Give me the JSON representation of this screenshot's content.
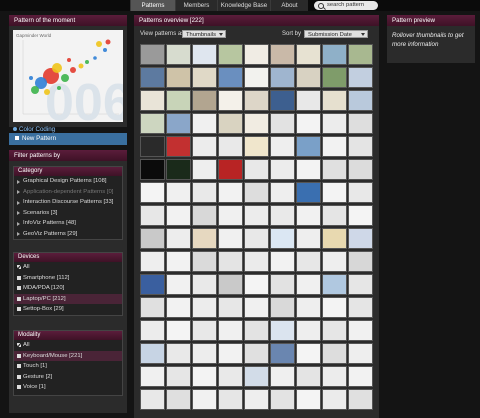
{
  "nav": {
    "tabs": [
      {
        "label": "Patterns",
        "active": true
      },
      {
        "label": "Members",
        "active": false
      },
      {
        "label": "Knowledge Base",
        "active": false
      },
      {
        "label": "About",
        "active": false
      }
    ],
    "search_placeholder": "search pattern"
  },
  "potm": {
    "title": "Pattern of the moment",
    "image_label": "Gapminder World",
    "year_overlay": "006",
    "color_link": "Color Coding"
  },
  "new_pattern_label": "New Pattern",
  "filter": {
    "title": "Filter patterns by",
    "category": {
      "title": "Category",
      "items": [
        {
          "label": "Graphical Design Patterns [108]",
          "dim": false
        },
        {
          "label": "Application-dependent Patterns [0]",
          "dim": true
        },
        {
          "label": "Interaction Discourse Patterns [33]",
          "dim": false
        },
        {
          "label": "Scenarios [3]",
          "dim": false
        },
        {
          "label": "InfoViz Patterns [48]",
          "dim": false
        },
        {
          "label": "GeoViz Patterns [29]",
          "dim": false
        }
      ]
    },
    "devices": {
      "title": "Devices",
      "items": [
        {
          "label": "All",
          "checked": true,
          "highlight": false
        },
        {
          "label": "Smartphone [112]",
          "checked": false,
          "highlight": false
        },
        {
          "label": "MDA/PDA [120]",
          "checked": false,
          "highlight": false
        },
        {
          "label": "Laptop/PC [212]",
          "checked": false,
          "highlight": true
        },
        {
          "label": "Settop-Box [29]",
          "checked": false,
          "highlight": false
        }
      ]
    },
    "modality": {
      "title": "Modality",
      "items": [
        {
          "label": "All",
          "checked": true,
          "highlight": false
        },
        {
          "label": "Keyboard/Mouse [221]",
          "checked": false,
          "highlight": true
        },
        {
          "label": "Touch [1]",
          "checked": false,
          "highlight": false
        },
        {
          "label": "Gesture [2]",
          "checked": false,
          "highlight": false
        },
        {
          "label": "Voice [1]",
          "checked": false,
          "highlight": false
        }
      ]
    }
  },
  "overview": {
    "title": "Patterns overview [222]",
    "view_label": "View patterns as",
    "view_value": "Thumbnails",
    "sort_label": "Sort by",
    "sort_value": "Submission Date",
    "thumb_colors": [
      "#9a9a9a",
      "#d7dccf",
      "#dfe6ef",
      "#b7c6a0",
      "#f0ece4",
      "#c9b9a8",
      "#e7e2d2",
      "#8fb0c8",
      "#a8b890",
      "#5d7aa0",
      "#cfc3a8",
      "#e0d9c7",
      "#6a8fbf",
      "#f2f2ee",
      "#9fb5cf",
      "#d8d2c2",
      "#7f9c6a",
      "#c2cfe0",
      "#e9e4d8",
      "#c8d4b8",
      "#b2a590",
      "#f4f1ea",
      "#ddd6c8",
      "#3d5f8f",
      "#e8e8e8",
      "#e6e0cf",
      "#b9c9dc",
      "#cdd6c0",
      "#8aa6c9",
      "#f0f0f0",
      "#d9d3c1",
      "#f1ece2",
      "#e2e2e2",
      "#f3f3f3",
      "#ececec",
      "#dedede",
      "#2a2a2a",
      "#c23030",
      "#ececec",
      "#e9e9e9",
      "#f0e6cc",
      "#eeeeee",
      "#7aa0c8",
      "#f2f2f2",
      "#e4e4e4",
      "#0b0b0b",
      "#1a2a1a",
      "#eeeeee",
      "#b82424",
      "#e8e8e8",
      "#ececec",
      "#f3f3f3",
      "#e0e0e0",
      "#dcdcdc",
      "#f4f4f4",
      "#f0f0f0",
      "#e9e9e9",
      "#f2f2f2",
      "#dddddd",
      "#eeeeee",
      "#3a6fb0",
      "#f3f3f3",
      "#e8e8e8",
      "#e7e7e7",
      "#f2f2f2",
      "#d8d8d8",
      "#f0f0f0",
      "#ececec",
      "#e9e9e9",
      "#f1f1f1",
      "#e5e5e5",
      "#f4f4f4",
      "#c9c9c9",
      "#ededed",
      "#e6d8c0",
      "#f0f0f0",
      "#e8e8e8",
      "#dbe7f3",
      "#eeeeee",
      "#e8d9b0",
      "#cfd8e8",
      "#eeeeee",
      "#f2f2f2",
      "#dadada",
      "#e4e4e4",
      "#ebebeb",
      "#f2f2f2",
      "#e7e7e7",
      "#eeeeee",
      "#d7d7d7",
      "#3a5f9f",
      "#f1f1f1",
      "#e9e9e9",
      "#c9c9c9",
      "#f4f4f4",
      "#e2e2e2",
      "#f0f0f0",
      "#b0c8e0",
      "#e6e6e6",
      "#e0e0e0",
      "#f2f2f2",
      "#ececec",
      "#e7e7e7",
      "#f0f0f0",
      "#d9d9d9",
      "#eeeeee",
      "#f3f3f3",
      "#e5e5e5",
      "#ececec",
      "#f4f4f4",
      "#e8e8e8",
      "#f0f0f0",
      "#e3e3e3",
      "#dbe4ef",
      "#eeeeee",
      "#e6e6e6",
      "#f1f1f1",
      "#c7d4e4",
      "#e9e9e9",
      "#ededed",
      "#f2f2f2",
      "#e0e0e0",
      "#6a86b0",
      "#f4f4f4",
      "#dddddd",
      "#eeeeee",
      "#f0f0f0",
      "#e6e6e6",
      "#f3f3f3",
      "#e9e9e9",
      "#d2dce8",
      "#efefef",
      "#e4e4e4",
      "#ececec",
      "#f2f2f2",
      "#e8e8e8",
      "#dfdfdf",
      "#f1f1f1",
      "#e6e6e6",
      "#eeeeee",
      "#e3e3e3",
      "#f4f4f4",
      "#ebebeb",
      "#e0e0e0"
    ]
  },
  "preview": {
    "title": "Pattern preview",
    "text": "Rollover thumbnails to get more information"
  }
}
